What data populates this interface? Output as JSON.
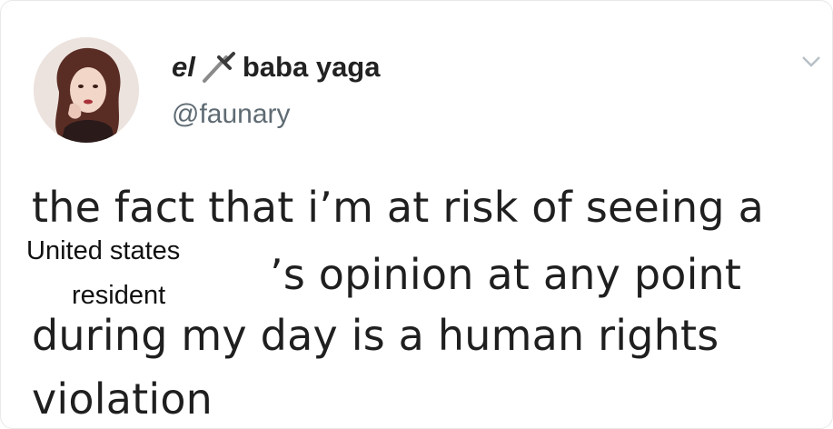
{
  "tweet": {
    "display_name_part1": "el",
    "display_name_part2": "baba yaga",
    "handle": "@faunary",
    "lines": [
      "the fact that i’m at risk of seeing a",
      "’s opinion at any point",
      "during my day is a human rights",
      "violation"
    ],
    "overlay": {
      "line1": "United states",
      "line2": "resident"
    }
  },
  "icons": {
    "name_emoji": "dagger-icon",
    "menu": "chevron-down-icon"
  },
  "colors": {
    "text": "#1f1f1f",
    "handle": "#5f6b73",
    "background": "#ffffff"
  }
}
